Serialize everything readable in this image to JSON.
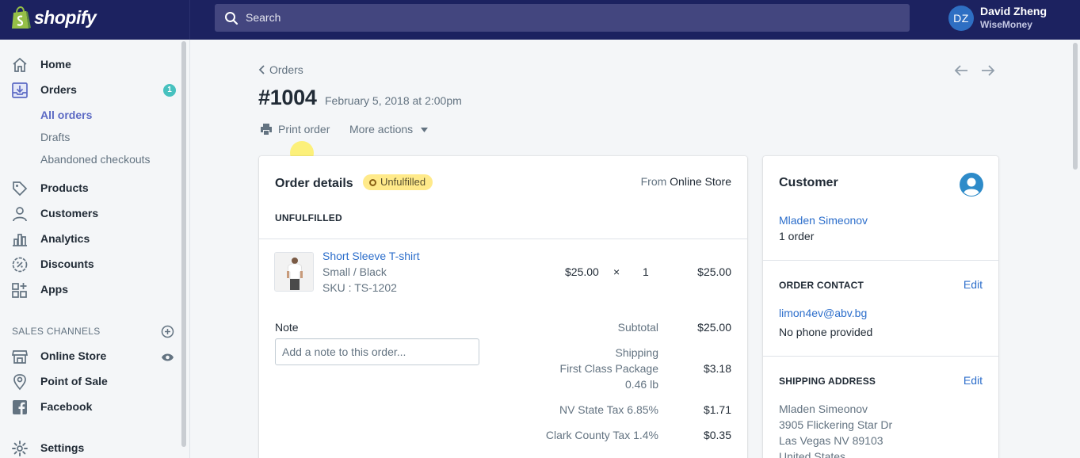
{
  "topbar": {
    "brand": "shopify",
    "search_placeholder": "Search",
    "user_initials": "DZ",
    "user_name": "David Zheng",
    "store_name": "WiseMoney",
    "colors": {
      "bar": "#1c2260",
      "search": "#43467f",
      "avatar": "#2e6fc3"
    }
  },
  "sidebar": {
    "items": [
      {
        "label": "Home",
        "icon": "home-icon"
      },
      {
        "label": "Orders",
        "icon": "orders-icon",
        "badge": "1"
      },
      {
        "label": "Products",
        "icon": "tag-icon"
      },
      {
        "label": "Customers",
        "icon": "person-icon"
      },
      {
        "label": "Analytics",
        "icon": "bar-chart-icon"
      },
      {
        "label": "Discounts",
        "icon": "discount-icon"
      },
      {
        "label": "Apps",
        "icon": "apps-icon"
      }
    ],
    "orders_sub": [
      "All orders",
      "Drafts",
      "Abandoned checkouts"
    ],
    "sales_channels_title": "SALES CHANNELS",
    "channels": [
      {
        "label": "Online Store",
        "icon": "store-icon"
      },
      {
        "label": "Point of Sale",
        "icon": "location-pin-icon"
      },
      {
        "label": "Facebook",
        "icon": "facebook-icon"
      }
    ],
    "settings_label": "Settings"
  },
  "page": {
    "breadcrumb": "Orders",
    "order_number": "#1004",
    "order_date": "February 5, 2018 at 2:00pm",
    "print_label": "Print order",
    "more_actions_label": "More actions"
  },
  "order_details": {
    "title": "Order details",
    "status": "Unfulfilled",
    "from_prefix": "From",
    "from_store": "Online Store",
    "section_label": "UNFULFILLED",
    "line_item": {
      "name": "Short Sleeve T-shirt",
      "variant": "Small / Black",
      "sku": "SKU : TS-1202",
      "price": "$25.00",
      "times": "×",
      "quantity": "1",
      "total": "$25.00"
    },
    "note_label": "Note",
    "note_placeholder": "Add a note to this order...",
    "summary": {
      "subtotal_label": "Subtotal",
      "subtotal": "$25.00",
      "shipping_label": "Shipping",
      "shipping_method": "First Class Package",
      "shipping_weight": "0.46 lb",
      "shipping": "$3.18",
      "state_tax_label": "NV State Tax 6.85%",
      "state_tax": "$1.71",
      "county_tax_label": "Clark County Tax 1.4%",
      "county_tax": "$0.35"
    }
  },
  "customer": {
    "title": "Customer",
    "name": "Mladen Simeonov",
    "order_count": "1 order",
    "contact_title": "ORDER CONTACT",
    "edit_label": "Edit",
    "email": "limon4ev@abv.bg",
    "phone": "No phone provided",
    "shipping_title": "SHIPPING ADDRESS",
    "address": [
      "Mladen Simeonov",
      "3905 Flickering Star Dr",
      "Las Vegas NV 89103",
      "United States"
    ]
  }
}
